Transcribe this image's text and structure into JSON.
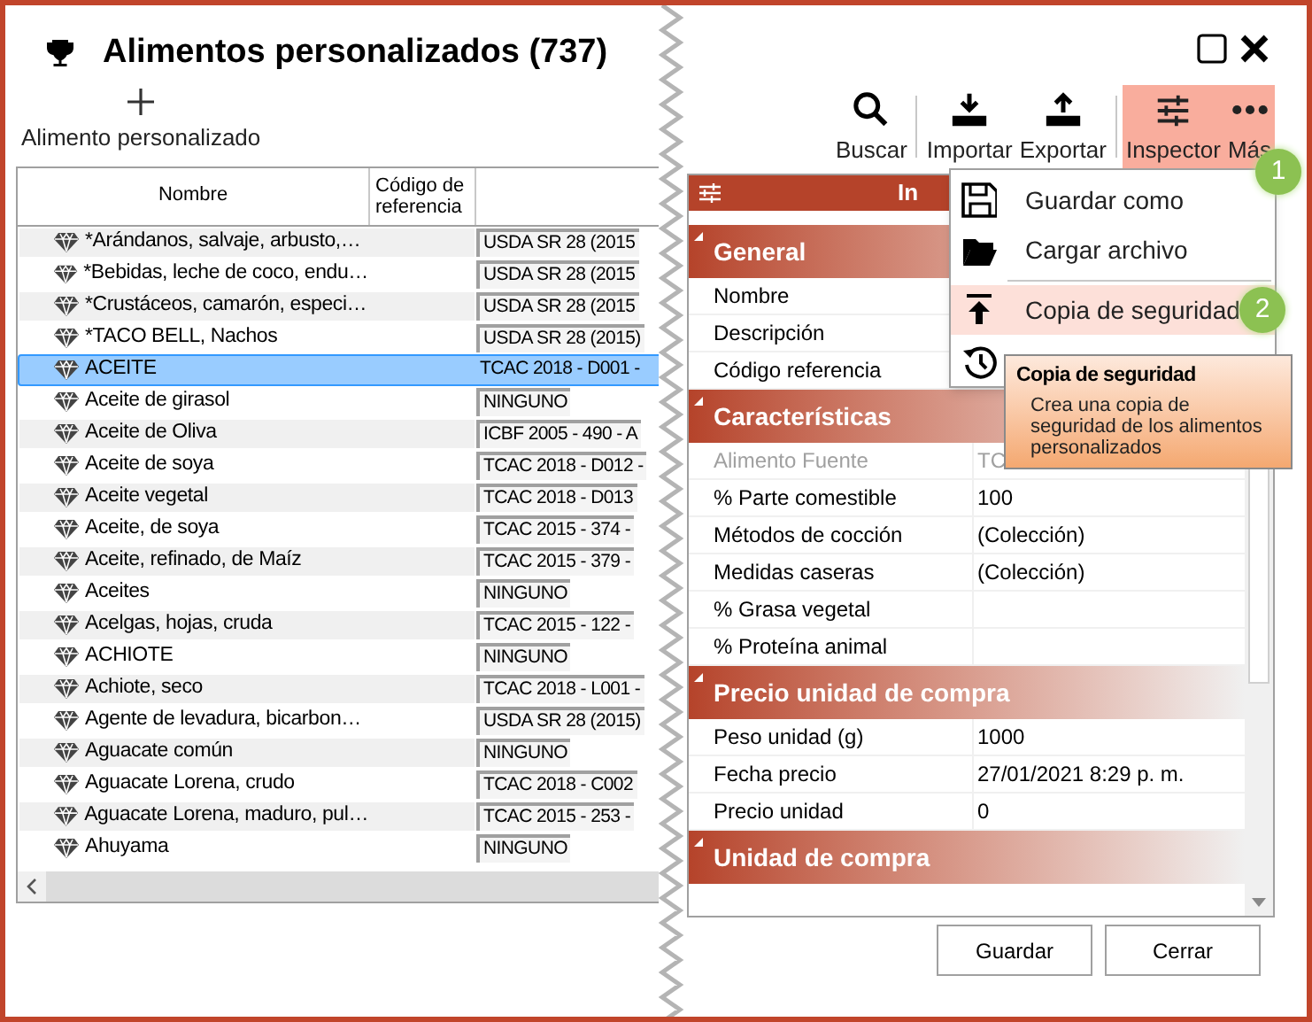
{
  "window": {
    "title": "Alimentos personalizados (737)"
  },
  "add_button": {
    "label": "Alimento personalizado"
  },
  "table": {
    "columns": [
      "Nombre",
      "Código de referencia"
    ],
    "rows": [
      {
        "name": "*Arándanos, salvaje, arbusto,…",
        "column_3": "USDA SR 28 (2015",
        "selected": false
      },
      {
        "name": "*Bebidas, leche de coco, endu…",
        "column_3": "USDA SR 28 (2015",
        "selected": false
      },
      {
        "name": "*Crustáceos, camarón, especi…",
        "column_3": "USDA SR 28 (2015",
        "selected": false
      },
      {
        "name": "*TACO BELL, Nachos",
        "column_3": "USDA SR 28 (2015)",
        "selected": false
      },
      {
        "name": "ACEITE",
        "column_3": "TCAC 2018 - D001 -",
        "selected": true
      },
      {
        "name": "Aceite de girasol",
        "column_3": "NINGUNO",
        "selected": false
      },
      {
        "name": "Aceite de Oliva",
        "column_3": "ICBF 2005 - 490 - A",
        "selected": false
      },
      {
        "name": "Aceite de soya",
        "column_3": "TCAC 2018 - D012 -",
        "selected": false
      },
      {
        "name": "Aceite vegetal",
        "column_3": "TCAC 2018 - D013",
        "selected": false
      },
      {
        "name": "Aceite, de soya",
        "column_3": "TCAC 2015 - 374 -",
        "selected": false
      },
      {
        "name": "Aceite, refinado, de Maíz",
        "column_3": "TCAC 2015 - 379 -",
        "selected": false
      },
      {
        "name": "Aceites",
        "column_3": "NINGUNO",
        "selected": false
      },
      {
        "name": "Acelgas, hojas, cruda",
        "column_3": "TCAC 2015 - 122 -",
        "selected": false
      },
      {
        "name": "ACHIOTE",
        "column_3": "NINGUNO",
        "selected": false
      },
      {
        "name": "Achiote, seco",
        "column_3": "TCAC 2018 - L001 -",
        "selected": false
      },
      {
        "name": "Agente de levadura, bicarbon…",
        "column_3": "USDA SR 28 (2015)",
        "selected": false
      },
      {
        "name": "Aguacate común",
        "column_3": "NINGUNO",
        "selected": false
      },
      {
        "name": "Aguacate Lorena, crudo",
        "column_3": "TCAC 2018 - C002",
        "selected": false
      },
      {
        "name": "Aguacate Lorena, maduro, pul…",
        "column_3": "TCAC 2015 - 253 -",
        "selected": false
      },
      {
        "name": "Ahuyama",
        "column_3": "NINGUNO",
        "selected": false
      }
    ]
  },
  "toolbar": [
    {
      "label": "Buscar",
      "selected": false
    },
    {
      "label": "Importar",
      "selected": false
    },
    {
      "label": "Exportar",
      "selected": false
    },
    {
      "label": "Inspector",
      "selected": true
    },
    {
      "label": "Más",
      "selected": true
    }
  ],
  "inspector": {
    "title": "In",
    "sections": [
      {
        "title": "General",
        "expanded": true,
        "rows": [
          {
            "label": "Nombre",
            "disabled": false
          },
          {
            "label": "Descripción",
            "disabled": false
          },
          {
            "label": "Código referencia",
            "disabled": false
          }
        ]
      },
      {
        "title": "Características",
        "expanded": true,
        "rows": [
          {
            "label": "Alimento Fuente",
            "value": "TC",
            "disabled": true
          },
          {
            "label": "% Parte comestible",
            "value": "100",
            "disabled": false
          },
          {
            "label": "Métodos de cocción",
            "value": "(Colección)",
            "disabled": false
          },
          {
            "label": "Medidas caseras",
            "value": "(Colección)",
            "disabled": false
          },
          {
            "label": "% Grasa vegetal",
            "disabled": false
          },
          {
            "label": "% Proteína animal",
            "disabled": false
          }
        ]
      },
      {
        "title": "Precio unidad de compra",
        "expanded": true,
        "rows": [
          {
            "label": "Peso unidad (g)",
            "value": "1000",
            "disabled": false
          },
          {
            "label": "Fecha precio",
            "value": "27/01/2021 8:29 p. m.",
            "disabled": false
          },
          {
            "label": "Precio unidad",
            "value": "0",
            "disabled": false
          }
        ]
      },
      {
        "title": "Unidad de compra",
        "expanded": true
      }
    ]
  },
  "buttons": [
    "Guardar",
    "Cerrar"
  ],
  "menu": {
    "items": [
      {
        "kind": "item",
        "label": "Guardar como",
        "selected": false
      },
      {
        "kind": "item",
        "label": "Cargar archivo",
        "selected": false
      },
      {
        "kind": "separator"
      },
      {
        "kind": "item",
        "label": "Copia de seguridad",
        "selected": true
      },
      {
        "kind": "item",
        "selected": false
      }
    ]
  },
  "tooltip": {
    "title": "Copia de seguridad",
    "text": "Crea una copia de seguridad de los alimentos personalizados"
  },
  "badges": [
    "1",
    "2"
  ]
}
